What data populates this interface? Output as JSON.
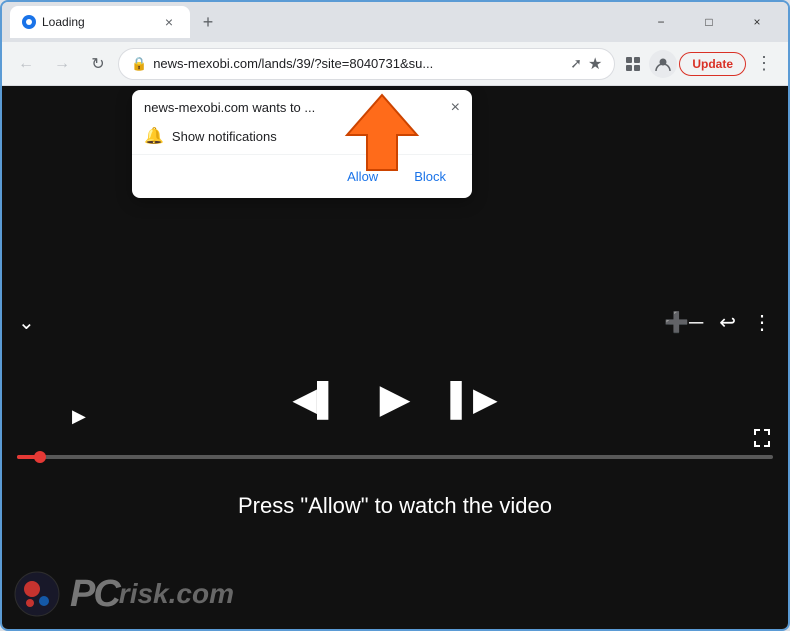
{
  "browser": {
    "tab": {
      "title": "Loading",
      "close_label": "×"
    },
    "new_tab_label": "+",
    "window_controls": {
      "minimize": "−",
      "maximize": "□",
      "close": "×"
    },
    "address_bar": {
      "url": "news-mexobi.com/lands/39/?site=8040731&su...",
      "lock": "🔒"
    },
    "update_button": "Update"
  },
  "notification_popup": {
    "title": "news-mexobi.com wants to ...",
    "close": "×",
    "message": "Show notifications",
    "allow_label": "Allow",
    "block_label": "Block"
  },
  "player": {
    "text_overlay": "Press \"Allow\" to watch the video",
    "progress_label": ""
  },
  "pcrisk": {
    "text": "risk.com"
  }
}
